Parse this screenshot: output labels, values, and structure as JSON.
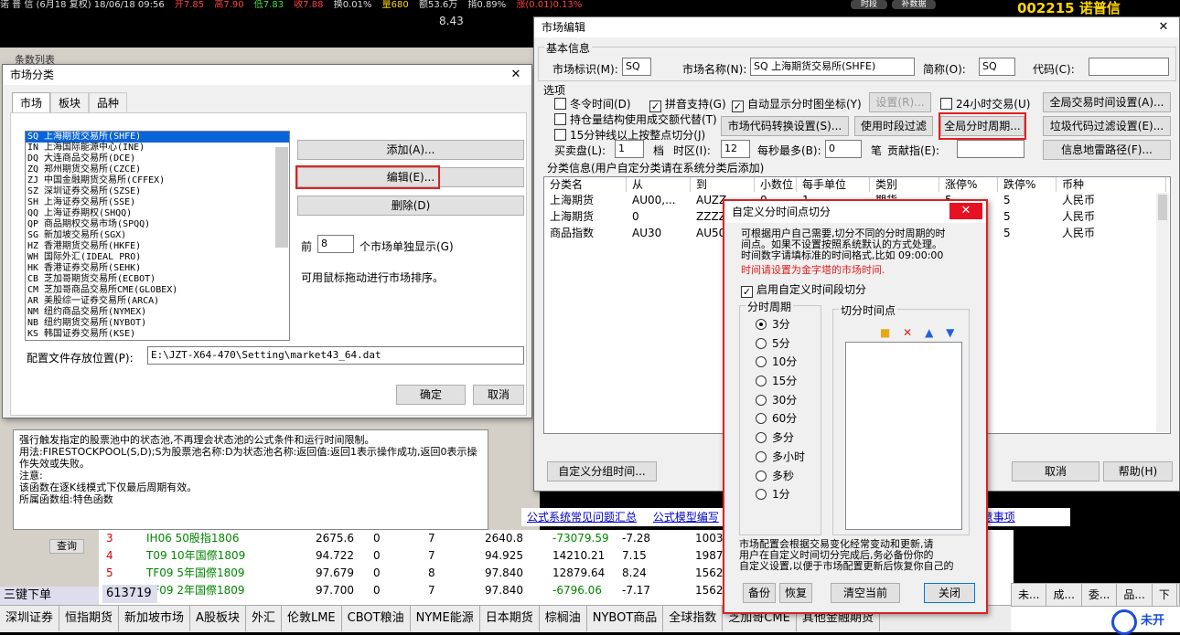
{
  "topbar": {
    "left": "诺 普 信 (6月18 复权) 18/06/18 09:56",
    "open": "开7.85",
    "high": "高7.90",
    "low": "低7.83",
    "close": "收7.88",
    "turnover": "换0.01%",
    "vol": "量680",
    "amt": "额53.6万",
    "amp": "掯0.89%",
    "chg": "涨(0.01)0.13%",
    "code": "002215",
    "name": "诺普信",
    "price": "8.43",
    "btn1": "时段",
    "btn2": "补数据"
  },
  "bg": {
    "bg_title": "条数列表",
    "func_text": "强行触发指定的股票池中的状态池,不再理会状态池的公式条件和运行时间限制。",
    "func_usage": "用法:FIRESTOCKPOOL(S,D);S为股票池名称:D为状态池名称:返回值:返回1表示操作成功,返回0表示操作失效或失败。",
    "func_note": "注意:",
    "func_note2": "该函数在逐K线模式下仅最后周期有效。",
    "func_group": "所属函数组:特色函数",
    "query": "查询",
    "search_code": "613719",
    "link1": "公式系统常见问题汇总",
    "link2": "公式模型编写",
    "link3": "的注意事项",
    "hotkey": "三键下单"
  },
  "quotes": [
    {
      "n": "3",
      "name": "IH06 50股指1806",
      "p": "2675.6",
      "a": "0",
      "b": "7",
      "c": "2640.8",
      "d": "-73079.59",
      "e": "-7.28",
      "f": "10034"
    },
    {
      "n": "4",
      "name": "T09 10年国傺1809",
      "p": "94.722",
      "a": "0",
      "b": "7",
      "c": "94.925",
      "d": "14210.21",
      "e": "7.15",
      "f": "19877"
    },
    {
      "n": "5",
      "name": "TF09 5年国傺1809",
      "p": "97.679",
      "a": "0",
      "b": "8",
      "c": "97.840",
      "d": "12879.64",
      "e": "8.24",
      "f": "15623"
    },
    {
      "n": "6",
      "name": "TF09 2年国傺1809",
      "p": "97.700",
      "a": "0",
      "b": "7",
      "c": "97.840",
      "d": "-6796.06",
      "e": "-7.17",
      "f": "15623"
    }
  ],
  "tabs": [
    "深圳证券",
    "恒指期货",
    "新加坡市场",
    "A股板块",
    "外汇",
    "伦敦LME",
    "CBOT粮油",
    "NYME能源",
    "日本期货",
    "棕榈油",
    "NYBOT商品",
    "全球指数",
    "芝加哥CME",
    "其他金融期货"
  ],
  "rtabs": [
    "未...",
    "成...",
    "委...",
    "品...",
    "下"
  ],
  "open_label": "未开",
  "market_dialog": {
    "title": "市场分类",
    "tabs": [
      "市场",
      "板块",
      "品种"
    ],
    "items": [
      "SQ 上海期货交易所(SHFE)",
      "IN 上海国际能源中心(INE)",
      "DQ 大连商品交易所(DCE)",
      "ZQ 郑州期货交易所(CZCE)",
      "ZJ 中国金融期货交易所(CFFEX)",
      "SZ 深圳证券交易所(SZSE)",
      "SH 上海证券交易所(SSE)",
      "QQ 上海证券期权(SHQQ)",
      "QP 商品期权交易市场(SPQQ)",
      "SG 新加坡交易所(SGX)",
      "HZ 香港期货交易所(HKFE)",
      "WH 国际外汇(IDEAL PRO)",
      "HK 香港证券交易所(SEHK)",
      "CB 芝加哥期货交易所(ECBOT)",
      "CM 芝加哥商品交易所CME(GLOBEX)",
      "AR 美股综一证券交易所(ARCA)",
      "NM 纽约商品交易所(NYMEX)",
      "NB 纽约期货交易所(NYBOT)",
      "KS 韩国证券交易所(KSE)"
    ],
    "add": "添加(A)...",
    "edit": "编辑(E)...",
    "del": "删除(D)",
    "front": "前",
    "count": "8",
    "count_suffix": "个市场单独显示(G)",
    "hint": "可用鼠标拖动进行市场排序。",
    "path_label": "配置文件存放位置(P):",
    "path": "E:\\JZT-X64-470\\Setting\\market43_64.dat",
    "ok": "确定",
    "cancel": "取消"
  },
  "edit_dialog": {
    "title": "市场编辑",
    "basic": "基本信息",
    "mid_label": "市场标识(M):",
    "mid": "SQ",
    "mname_label": "市场名称(N):",
    "mname": "SQ 上海期货交易所(SHFE)",
    "abbr_label": "简称(O):",
    "abbr": "SQ",
    "code_label": "代码(C):",
    "code": "",
    "options": "选项",
    "c_winter": "冬令时间(D)",
    "c_pinyin": "拼音支持(G)",
    "c_auto": "自动显示分时图坐标(Y)",
    "set": "设置(R)...",
    "c_24h": "24小时交易(U)",
    "global_time": "全局交易时间设置(A)...",
    "c_pos": "持仓量结构使用成交额代替(T)",
    "c_15": "15分钟线以上按整点切分(J)",
    "code_conv": "市场代码转换设置(S)...",
    "use_period": "使用时段过滤",
    "global_period": "全局分时周期...",
    "junk": "垃圾代码过滤设置(E)...",
    "buysell_label": "买卖盘(L):",
    "buysell": "1",
    "tick_label": "档",
    "tz_label": "时区(I):",
    "tz": "12",
    "sec_label": "每秒最多(B):",
    "sec": "0",
    "sec_unit": "笔",
    "contrib_label": "贡献指(E):",
    "contrib": "",
    "mine": "信息地雷路径(F)...",
    "cls_label": "分类信息(用户自定分类请在系统分类后添加)",
    "cols": [
      "分类名",
      "从",
      "到",
      "小数位",
      "每手单位",
      "类别",
      "涨停%",
      "跌停%",
      "币种"
    ],
    "rows": [
      [
        "上海期货",
        "AU00,...",
        "AUZZ,...",
        "0",
        "1",
        "期货",
        "5",
        "5",
        "人民币"
      ],
      [
        "上海期货",
        "0",
        "ZZZZZZ",
        "0",
        "1",
        "期货",
        "5",
        "5",
        "人民币"
      ],
      [
        "商品指数",
        "AU30",
        "AU50",
        "0",
        "1",
        "指数",
        "5",
        "5",
        "人民币"
      ]
    ],
    "custom_group": "自定义分组时间...",
    "ok": "确定",
    "cancel": "取消",
    "help": "帮助(H)"
  },
  "cut_dialog": {
    "title": "自定义分时间点切分",
    "desc1": "可根据用户自己需要,切分不同的分时周期的时",
    "desc2": "间点。如果不设置按照系统默认的方式处理。",
    "desc3": "时间数字请填标准的时间格式,比如 09:00:00",
    "warn": "时间请设置为金字塔的市场时间.",
    "enable": "启用自定义时间段切分",
    "period": "分时周期",
    "cutpoint": "切分时间点",
    "periods": [
      "3分",
      "5分",
      "10分",
      "15分",
      "30分",
      "60分",
      "多分",
      "多小时",
      "多秒",
      "1分"
    ],
    "foot1": "市场配置会根据交易变化经常变动和更新,请",
    "foot2": "用户在自定义时间切分完成后,务必备份你的",
    "foot3": "自定义设置,以便于市场配置更新后恢复你自己的",
    "backup": "备份",
    "restore": "恢复",
    "clear": "清空当前",
    "close": "关闭"
  }
}
